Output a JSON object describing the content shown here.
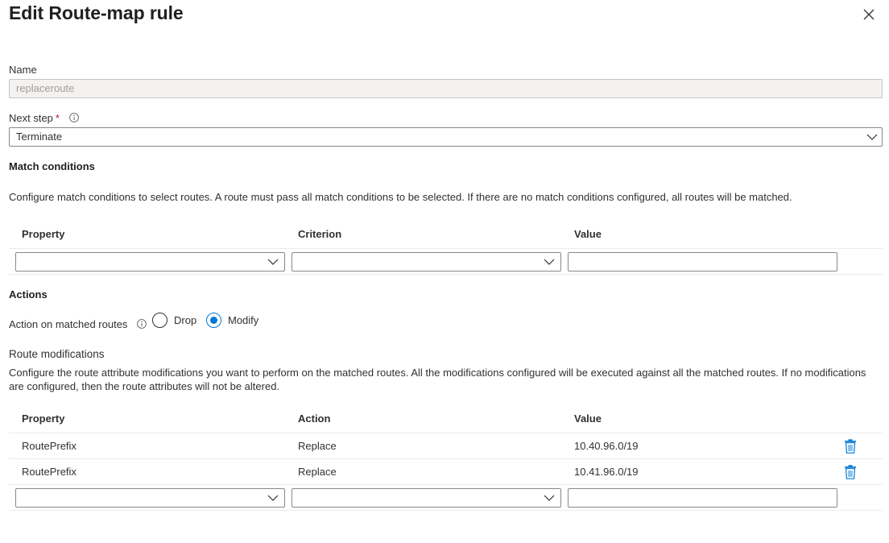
{
  "header": {
    "title": "Edit Route-map rule"
  },
  "name_field": {
    "label": "Name",
    "value": "replaceroute"
  },
  "next_step": {
    "label": "Next step",
    "required_marker": "*",
    "value": "Terminate"
  },
  "match_conditions": {
    "title": "Match conditions",
    "description": "Configure match conditions to select routes. A route must pass all match conditions to be selected. If there are no match conditions configured, all routes will be matched.",
    "columns": [
      "Property",
      "Criterion",
      "Value"
    ]
  },
  "actions": {
    "title": "Actions",
    "action_label": "Action on matched routes",
    "options": [
      "Drop",
      "Modify"
    ],
    "selected": "Modify"
  },
  "route_modifications": {
    "title": "Route modifications",
    "description": "Configure the route attribute modifications you want to perform on the matched routes. All the modifications configured will be executed against all the matched routes. If no modifications are configured, then the route attributes will not be altered.",
    "columns": [
      "Property",
      "Action",
      "Value"
    ],
    "rows": [
      {
        "property": "RoutePrefix",
        "action": "Replace",
        "value": "10.40.96.0/19"
      },
      {
        "property": "RoutePrefix",
        "action": "Replace",
        "value": "10.41.96.0/19"
      }
    ]
  },
  "icons": {
    "close": "close-icon",
    "info": "info-icon",
    "chevron": "chevron-down-icon",
    "delete": "trash-icon"
  },
  "colors": {
    "accent": "#0078d4",
    "required": "#a4262c",
    "delete_icon": "#0078d4"
  }
}
